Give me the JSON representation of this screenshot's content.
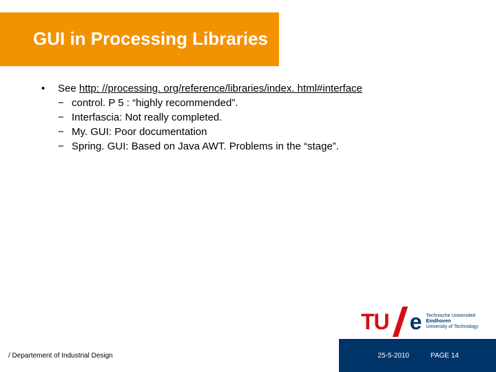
{
  "title": "GUI in Processing Libraries",
  "main_bullet_prefix": "See ",
  "main_bullet_link": "http: //processing. org/reference/libraries/index. html#interface",
  "items": [
    "control. P 5 : “highly recommended”.",
    "Interfascia: Not really completed.",
    "My. GUI:  Poor documentation",
    "Spring. GUI:  Based on Java AWT. Problems in the “stage”."
  ],
  "footer": {
    "department": "/ Departement of Industrial Design",
    "date": "25-5-2010",
    "page": "PAGE 14",
    "logo_tu": "TU",
    "logo_e": "e",
    "logo_side_1": "Technische Universiteit",
    "logo_side_2": "Eindhoven",
    "logo_side_3": "University of Technology"
  }
}
